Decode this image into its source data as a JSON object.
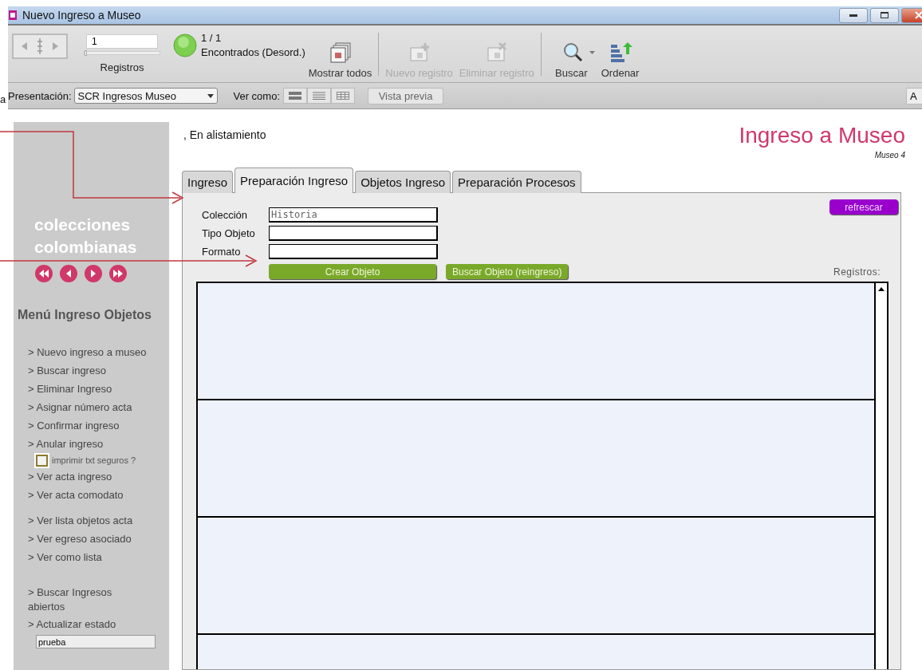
{
  "window": {
    "title": "Nuevo Ingreso a Museo",
    "controls": [
      {
        "kind": "minimize"
      },
      {
        "kind": "maximize"
      },
      {
        "kind": "close"
      }
    ]
  },
  "edge_texts": {
    "left": "a",
    "right_button": "A"
  },
  "toolbar": {
    "record": {
      "value": "1",
      "label": "Registros",
      "level": 0
    },
    "found": {
      "count": "1 / 1",
      "status": "Encontrados (Desord.)"
    },
    "buttons": [
      {
        "kind": "show-all",
        "label": "Mostrar todos",
        "disabled": false,
        "separator_after": true
      },
      {
        "kind": "new",
        "label": "Nuevo registro",
        "disabled": true,
        "separator_after": false
      },
      {
        "kind": "delete",
        "label": "Eliminar registro",
        "disabled": true,
        "separator_after": true
      },
      {
        "kind": "search",
        "label": "Buscar",
        "disabled": false,
        "separator_after": false
      },
      {
        "kind": "sort",
        "label": "Ordenar",
        "disabled": false,
        "separator_after": false
      }
    ]
  },
  "layout_bar": {
    "label": "Presentación:",
    "layout": "SCR Ingresos Museo",
    "view_label": "Ver como:",
    "views": [
      {
        "kind": "form"
      },
      {
        "kind": "list"
      },
      {
        "kind": "table"
      }
    ],
    "preview": "Vista previa"
  },
  "sidebar": {
    "brand": "colecciones colombianas",
    "nav": [
      {
        "kind": "first"
      },
      {
        "kind": "prev"
      },
      {
        "kind": "next"
      },
      {
        "kind": "last"
      }
    ],
    "menu_title": "Menú Ingreso Objetos",
    "groups": [
      [
        {
          "kind": "link",
          "text": "> Nuevo ingreso a museo"
        },
        {
          "kind": "link",
          "text": "> Buscar ingreso"
        },
        {
          "kind": "link",
          "text": "> Eliminar Ingreso"
        },
        {
          "kind": "link",
          "text": "> Asignar número acta"
        },
        {
          "kind": "link",
          "text": "> Confirmar ingreso"
        },
        {
          "kind": "link",
          "text": "> Anular ingreso"
        },
        {
          "kind": "checkbox",
          "text": "imprimir txt seguros ?",
          "checked": false
        },
        {
          "kind": "link",
          "text": "> Ver acta ingreso"
        },
        {
          "kind": "link",
          "text": "> Ver acta comodato"
        }
      ],
      [
        {
          "kind": "link",
          "text": "> Ver lista objetos acta"
        },
        {
          "kind": "link",
          "text": "> Ver egreso asociado"
        },
        {
          "kind": "link",
          "text": "> Ver como lista"
        }
      ],
      [
        {
          "kind": "link",
          "text": "> Buscar Ingresos abiertos"
        },
        {
          "kind": "link",
          "text": "> Actualizar estado"
        },
        {
          "kind": "field",
          "value": "prueba"
        }
      ]
    ]
  },
  "main": {
    "status": ", En alistamiento",
    "title": "Ingreso a Museo",
    "subtitle": "Museo 4",
    "tabs": [
      {
        "label": "Ingreso",
        "selected": false
      },
      {
        "label": "Preparación Ingreso",
        "selected": true
      },
      {
        "label": "Objetos Ingreso",
        "selected": false
      },
      {
        "label": "Preparación Procesos",
        "selected": false
      }
    ],
    "refresh": "refrescar",
    "fields": [
      {
        "label": "Colección",
        "value": "Historia"
      },
      {
        "label": "Tipo Objeto"
      },
      {
        "label": "Formato"
      }
    ],
    "actions": [
      "Crear Objeto",
      "Buscar Objeto (reingreso)"
    ],
    "portal_label": "Registros:"
  }
}
